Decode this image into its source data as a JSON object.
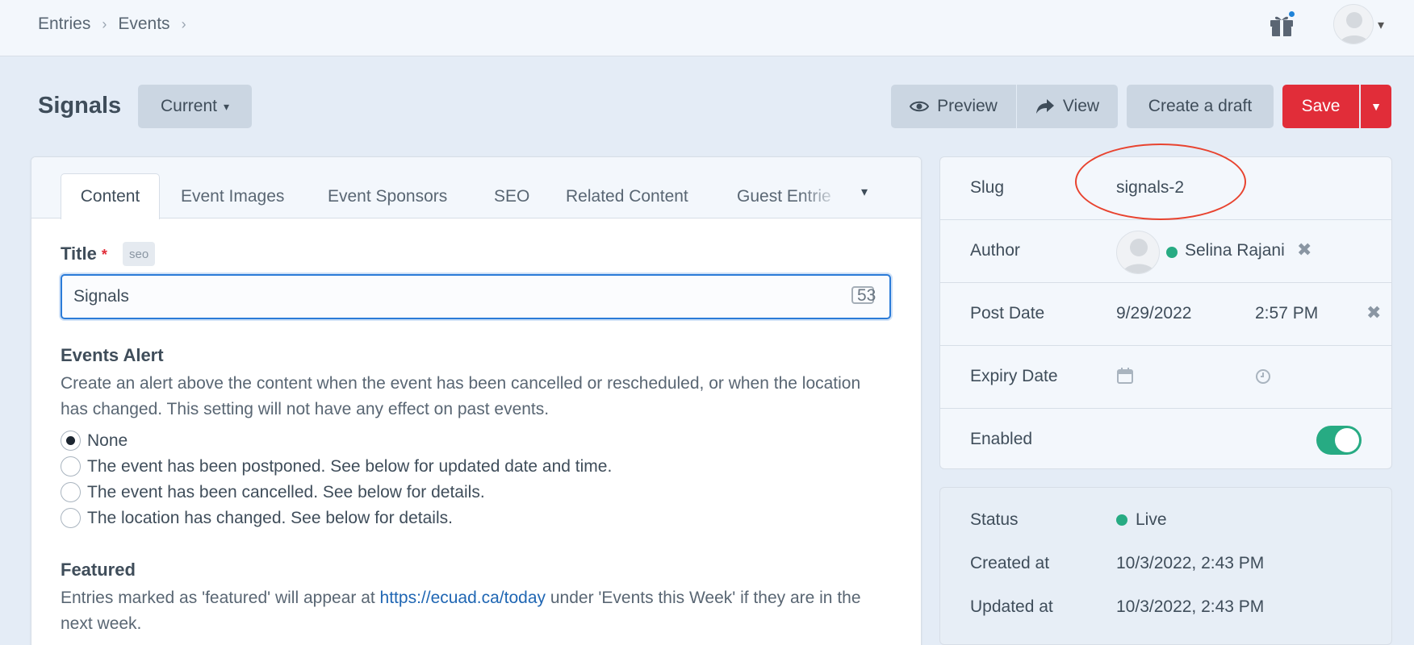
{
  "breadcrumb": {
    "items": [
      "Entries",
      "Events"
    ]
  },
  "header": {
    "title": "Signals",
    "revision_label": "Current",
    "preview_label": "Preview",
    "view_label": "View",
    "create_draft_label": "Create a draft",
    "save_label": "Save"
  },
  "tabs": [
    {
      "label": "Content",
      "active": true
    },
    {
      "label": "Event Images"
    },
    {
      "label": "Event Sponsors"
    },
    {
      "label": "SEO"
    },
    {
      "label": "Related Content"
    },
    {
      "label": "Guest Entrie"
    }
  ],
  "fields": {
    "title": {
      "label": "Title",
      "required_mark": "*",
      "tag": "seo",
      "value": "Signals",
      "char_count": "53"
    },
    "events_alert": {
      "label": "Events Alert",
      "instructions": "Create an alert above the content when the event has been cancelled or rescheduled, or when the location has changed. This setting will not have any effect on past events.",
      "options": [
        {
          "label": "None",
          "checked": true
        },
        {
          "label": "The event has been postponed. See below for updated date and time.",
          "checked": false
        },
        {
          "label": "The event has been cancelled. See below for details.",
          "checked": false
        },
        {
          "label": "The location has changed. See below for details.",
          "checked": false
        }
      ]
    },
    "featured": {
      "label": "Featured",
      "instructions_before": "Entries marked as 'featured' will appear at ",
      "link_text": "https://ecuad.ca/today",
      "instructions_after": " under 'Events this Week' if they are in the next week."
    }
  },
  "sidebar": {
    "slug": {
      "label": "Slug",
      "value": "signals-2"
    },
    "author": {
      "label": "Author",
      "name": "Selina Rajani"
    },
    "post_date": {
      "label": "Post Date",
      "date": "9/29/2022",
      "time": "2:57 PM"
    },
    "expiry_date": {
      "label": "Expiry Date"
    },
    "enabled": {
      "label": "Enabled",
      "on": true
    }
  },
  "meta": {
    "status_label": "Status",
    "status_value": "Live",
    "created_label": "Created at",
    "created_value": "10/3/2022, 2:43 PM",
    "updated_label": "Updated at",
    "updated_value": "10/3/2022, 2:43 PM"
  },
  "colors": {
    "primary": "#e12d39",
    "accent": "#2b7bd8",
    "live": "#27ab83",
    "annotation": "#e8432f"
  }
}
